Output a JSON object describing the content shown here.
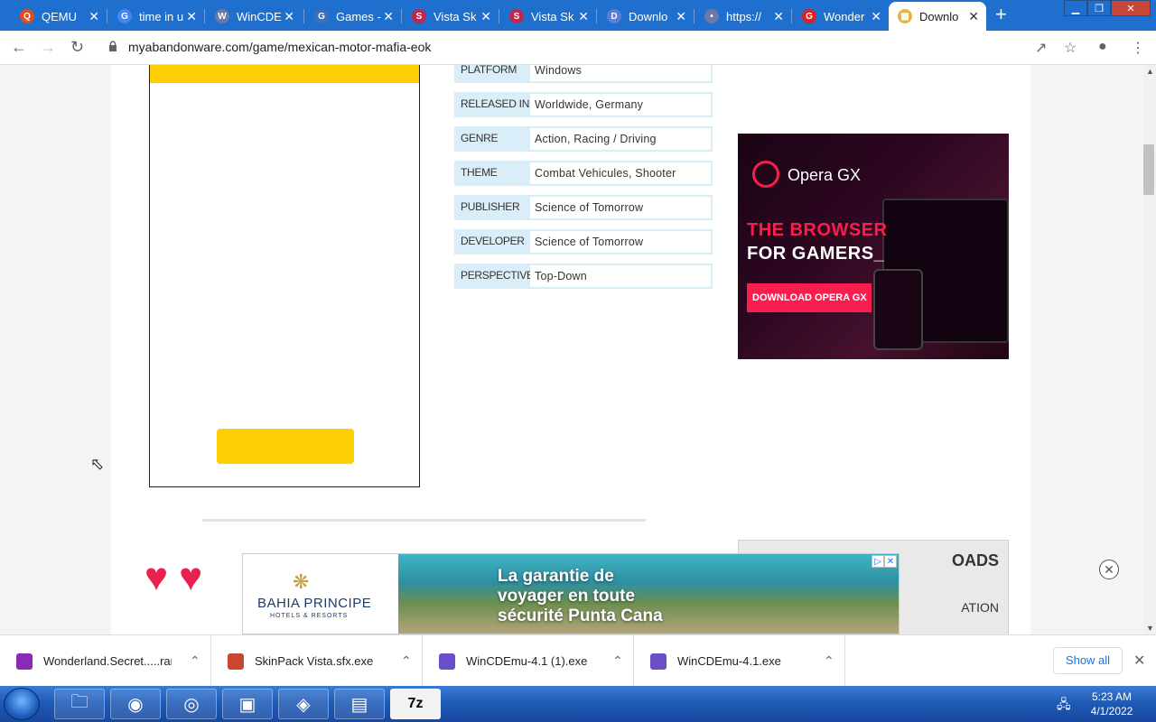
{
  "browser": {
    "tabs": [
      {
        "title": "QEMU",
        "favicon_color": "#e34a1c",
        "favicon_glyph": "Q"
      },
      {
        "title": "time in u",
        "favicon_color": "#4285f4",
        "favicon_glyph": "G"
      },
      {
        "title": "WinCDEmu",
        "favicon_color": "#6a7aa8",
        "favicon_glyph": "W"
      },
      {
        "title": "Games -",
        "favicon_color": "#3b6fb6",
        "favicon_glyph": "G"
      },
      {
        "title": "Vista Sk",
        "favicon_color": "#c2264c",
        "favicon_glyph": "S"
      },
      {
        "title": "Vista Sk",
        "favicon_color": "#c2264c",
        "favicon_glyph": "S"
      },
      {
        "title": "Downlo",
        "favicon_color": "#5b7fd6",
        "favicon_glyph": "D"
      },
      {
        "title": "https://",
        "favicon_color": "#6a7aa8",
        "favicon_glyph": "•"
      },
      {
        "title": "Wonder",
        "favicon_color": "#e02020",
        "favicon_glyph": "G"
      },
      {
        "title": "Downlo",
        "favicon_color": "#e8b53c",
        "favicon_glyph": "▦",
        "active": true
      }
    ],
    "new_tab": "+",
    "window_buttons": {
      "minimize": "▁",
      "restore": "❐",
      "close": "✕"
    },
    "url": "myabandonware.com/game/mexican-motor-mafia-eok"
  },
  "game_info": {
    "rows": [
      {
        "key": "PLATFORM",
        "value": "Windows"
      },
      {
        "key": "RELEASED IN",
        "value": "Worldwide, Germany"
      },
      {
        "key": "GENRE",
        "value": "Action, Racing / Driving"
      },
      {
        "key": "THEME",
        "value": "Combat Vehicules, Shooter"
      },
      {
        "key": "PUBLISHER",
        "value": "Science of Tomorrow"
      },
      {
        "key": "DEVELOPER",
        "value": "Science of Tomorrow"
      },
      {
        "key": "PERSPECTIVE",
        "value": "Top-Down"
      }
    ]
  },
  "ad_opera": {
    "brand": "Opera GX",
    "line1": "THE BROWSER",
    "line2": "FOR GAMERS_",
    "cta": "DOWNLOAD OPERA GX"
  },
  "sidebar_box": {
    "title": "OADS",
    "subtitle": "ATION"
  },
  "ad_banner": {
    "logo_line1": "BAHIA PRINCIPE",
    "logo_line2": "HOTELS & RESORTS",
    "headline": "La garantie de voyager en toute sécurité Punta Cana"
  },
  "downloads": {
    "items": [
      {
        "name": "Wonderland.Secret.....rar",
        "icon_color": "#8a2bb8"
      },
      {
        "name": "SkinPack Vista.sfx.exe",
        "icon_color": "#c8472e"
      },
      {
        "name": "WinCDEmu-4.1 (1).exe",
        "icon_color": "#6a4fc8"
      },
      {
        "name": "WinCDEmu-4.1.exe",
        "icon_color": "#6a4fc8"
      }
    ],
    "show_all": "Show all"
  },
  "taskbar": {
    "time": "5:23 AM",
    "date": "4/1/2022",
    "apps": [
      {
        "name": "explorer",
        "glyph": "🗀"
      },
      {
        "name": "firefox",
        "glyph": "◉"
      },
      {
        "name": "chrome",
        "glyph": "◎"
      },
      {
        "name": "app-4",
        "glyph": "▣"
      },
      {
        "name": "app-5",
        "glyph": "◈"
      },
      {
        "name": "app-6",
        "glyph": "▤"
      },
      {
        "name": "7zip",
        "glyph": "7z"
      }
    ]
  }
}
